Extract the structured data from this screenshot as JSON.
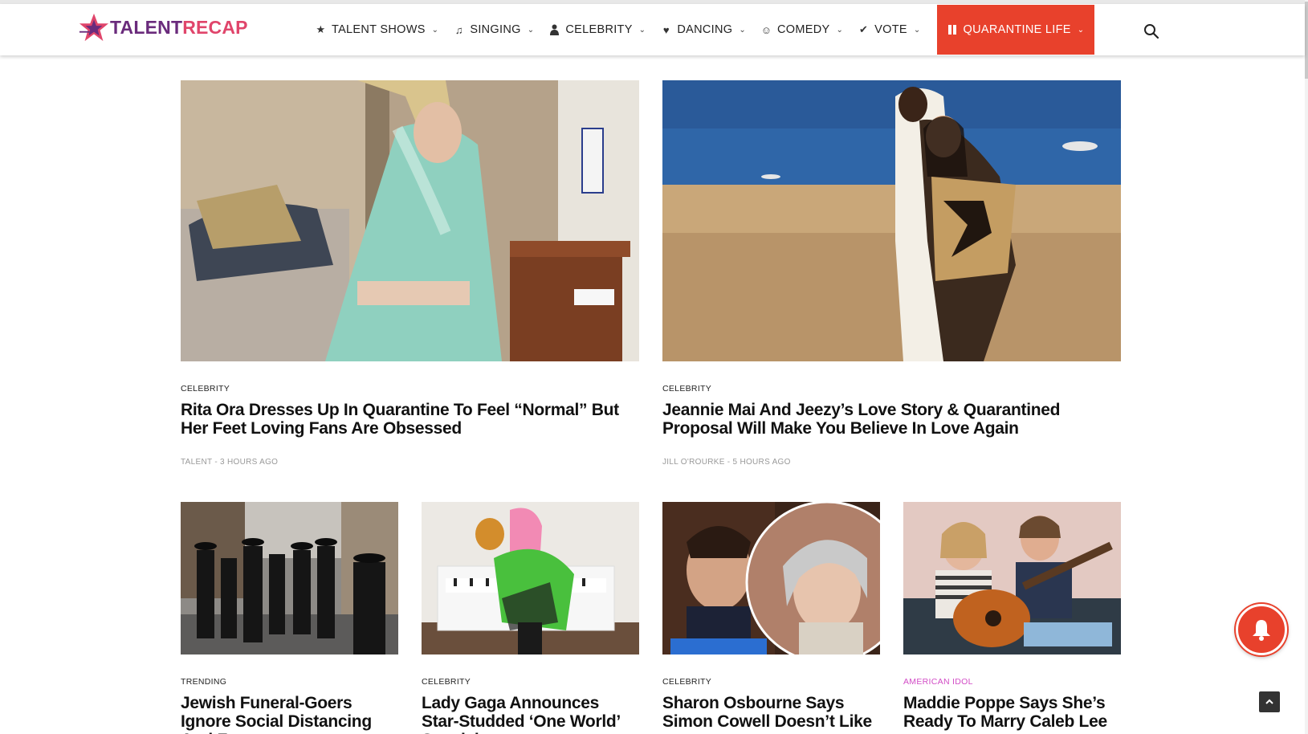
{
  "brand": {
    "logo_part1": "TALENT",
    "logo_part2": "RECAP",
    "accent": "#e8412c",
    "purple": "#6a2b7c",
    "pink": "#e0456b"
  },
  "nav": [
    {
      "label": "TALENT SHOWS",
      "icon": "star-icon"
    },
    {
      "label": "SINGING",
      "icon": "music-note-icon"
    },
    {
      "label": "CELEBRITY",
      "icon": "person-icon"
    },
    {
      "label": "DANCING",
      "icon": "heart-icon"
    },
    {
      "label": "COMEDY",
      "icon": "smiley-icon"
    },
    {
      "label": "VOTE",
      "icon": "check-icon"
    },
    {
      "label": "QUARANTINE LIFE",
      "icon": "pause-icon",
      "highlight": true
    }
  ],
  "search": {
    "icon": "search-icon"
  },
  "featured": [
    {
      "category": "CELEBRITY",
      "title": "Rita Ora Dresses Up In Quarantine To Feel “Normal” But Her Feet Loving Fans Are Obsessed",
      "author": "TALENT",
      "time": "3 HOURS AGO"
    },
    {
      "category": "CELEBRITY",
      "title": "Jeannie Mai And Jeezy’s Love Story & Quarantined Proposal Will Make You Believe In Love Again",
      "author": "JILL O'ROURKE",
      "time": "5 HOURS AGO"
    }
  ],
  "grid": [
    {
      "category": "TRENDING",
      "title": "Jewish Funeral-Goers Ignore Social Distancing And Force"
    },
    {
      "category": "CELEBRITY",
      "title": "Lady Gaga Announces Star-Studded ‘One World’ Special"
    },
    {
      "category": "CELEBRITY",
      "title": "Sharon Osbourne Says Simon Cowell Doesn’t Like"
    },
    {
      "category": "AMERICAN IDOL",
      "title": "Maddie Poppe Says She’s Ready To Marry Caleb Lee"
    }
  ],
  "widgets": {
    "notification_icon": "bell-icon",
    "back_to_top_icon": "chevron-up-icon"
  }
}
